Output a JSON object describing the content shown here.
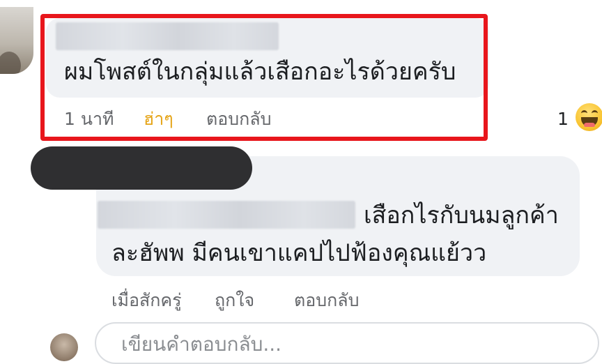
{
  "comment_1": {
    "text": "ผมโพสต์ในกลุ่มแล้วเสือกอะไรด้วยครับ",
    "time": "1 นาที",
    "reaction_label": "ฮ่าๆ",
    "reply_label": "ตอบกลับ",
    "reaction_count": "1",
    "reaction_icon": "haha-emoji-icon",
    "highlight_color": "#e8161c"
  },
  "comment_2": {
    "line_1": "เสือกไรกับนมลูกค้า",
    "line_2": "ละฮัพพ มีคนเขาแคปไปฟ้องคุณแย้วว",
    "time": "เมื่อสักครู่",
    "like_label": "ถูกใจ",
    "reply_label": "ตอบกลับ"
  },
  "composer": {
    "placeholder": "เขียนคำตอบกลับ..."
  }
}
